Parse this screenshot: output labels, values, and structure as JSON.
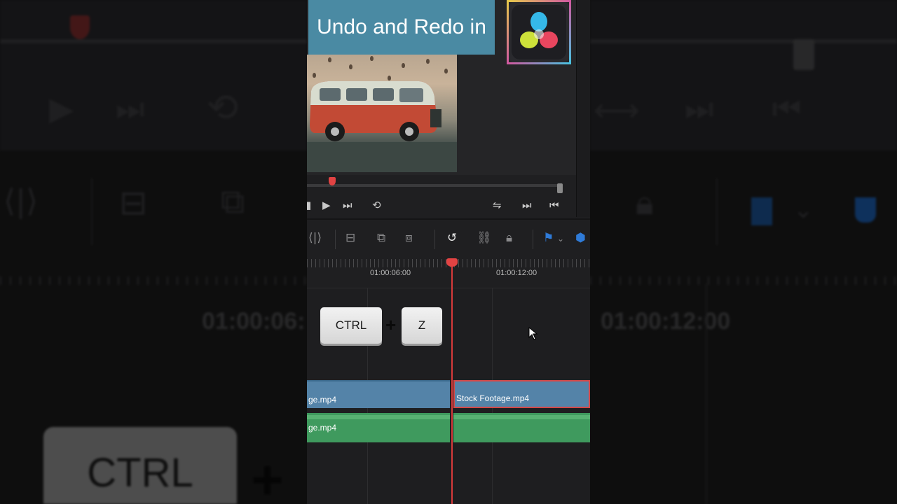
{
  "banner": {
    "title": "Undo and Redo in"
  },
  "logo": {
    "name": "davinci-resolve-logo"
  },
  "timeline": {
    "timecodes": [
      "01:00:06:00",
      "01:00:12:00"
    ],
    "clips": {
      "video_left": "ge.mp4",
      "video_right": "Stock Footage.mp4",
      "audio_left": "ge.mp4"
    }
  },
  "shortcut": {
    "key1": "CTRL",
    "plus": "+",
    "key2": "Z"
  },
  "background": {
    "timecode_left": "01:00:06:",
    "timecode_right": "01:00:12:00",
    "key_label": "CTRL",
    "plus": "+"
  },
  "colors": {
    "banner": "#4a8aa3",
    "playhead": "#d83a3a",
    "video_clip": "#5483a8",
    "audio_clip": "#3f9a5e",
    "marker": "#2f7bd8"
  }
}
